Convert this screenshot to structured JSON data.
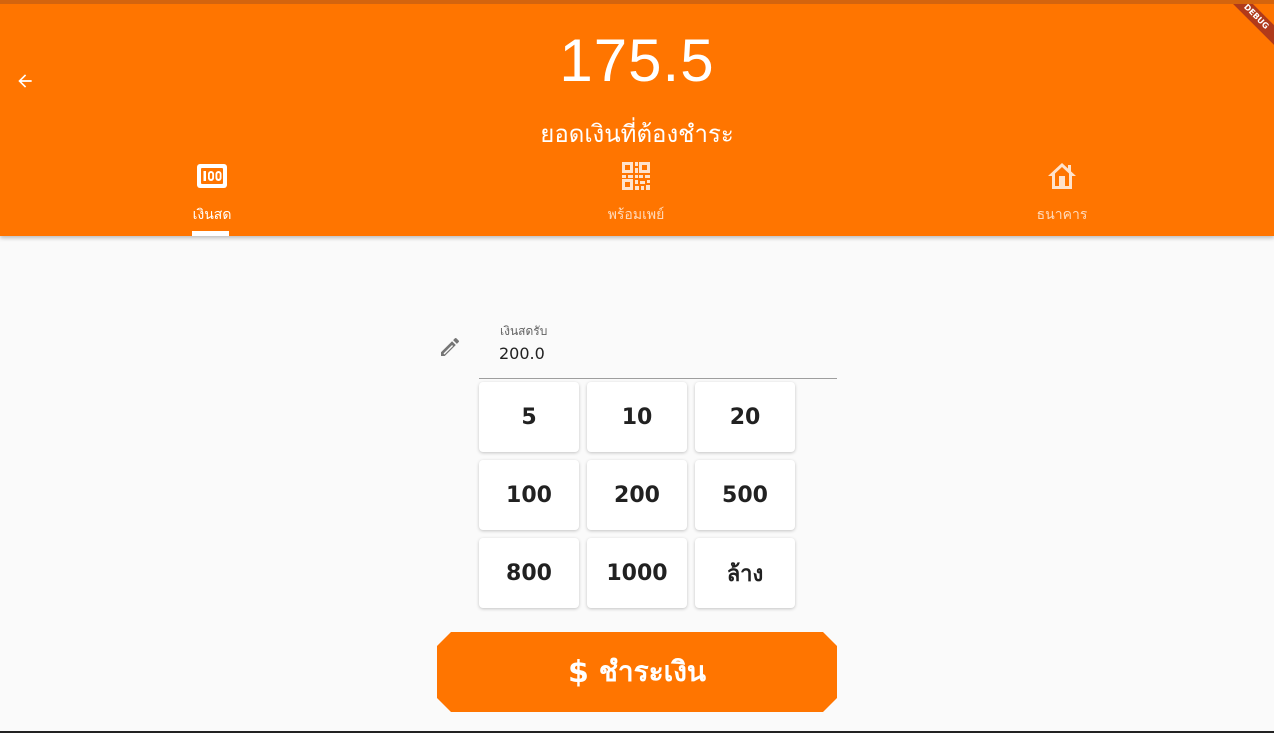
{
  "header": {
    "amount": "175.5",
    "subtitle": "ยอดเงินที่ต้องชำระ",
    "debug_banner": "DEBUG"
  },
  "tabs": [
    {
      "label": "เงินสด",
      "icon": "cash-icon",
      "active": true
    },
    {
      "label": "พร้อมเพย์",
      "icon": "qr-code-icon",
      "active": false
    },
    {
      "label": "ธนาคาร",
      "icon": "bank-icon",
      "active": false
    }
  ],
  "cash_field": {
    "label": "เงินสดรับ",
    "value": "200.0"
  },
  "keypad": [
    "5",
    "10",
    "20",
    "100",
    "200",
    "500",
    "800",
    "1000",
    "ล้าง"
  ],
  "pay_button": {
    "symbol": "$",
    "label": "ชำระเงิน"
  },
  "colors": {
    "primary": "#ff7500",
    "background": "#fafafa"
  }
}
